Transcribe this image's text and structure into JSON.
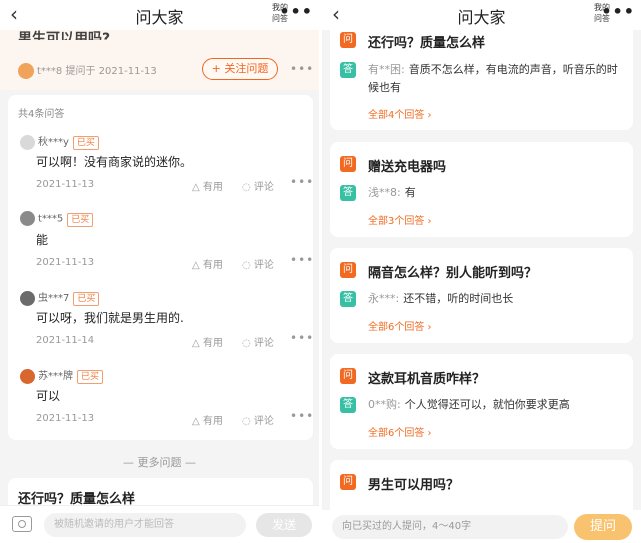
{
  "left": {
    "nav": {
      "back": "‹",
      "title": "问大家",
      "mine": "我的问答",
      "more": "•••"
    },
    "question": {
      "cut_title": "男生可以用吗?",
      "user": "t***8",
      "asked_on": "提问于 2021-11-13",
      "follow_label": "+ 关注问题",
      "more": "•••"
    },
    "answer_count": "共4条问答",
    "answers": [
      {
        "user": "秋***y",
        "badge": "已买",
        "text": "可以啊！没有商家说的迷你。",
        "date": "2021-11-13",
        "useful": "有用",
        "comment": "评论",
        "more": "•••",
        "avatar_color": "#d9d9d9"
      },
      {
        "user": "t***5",
        "badge": "已买",
        "text": "能",
        "date": "2021-11-13",
        "useful": "有用",
        "comment": "评论",
        "more": "•••",
        "avatar_color": "#8a8a8a"
      },
      {
        "user": "虫***7",
        "badge": "已买",
        "text": "可以呀，我们就是男生用的.",
        "date": "2021-11-14",
        "useful": "有用",
        "comment": "评论",
        "more": "•••",
        "avatar_color": "#6b6b6b"
      },
      {
        "user": "苏***牌",
        "badge": "已买",
        "text": "可以",
        "date": "2021-11-13",
        "useful": "有用",
        "comment": "评论",
        "more": "•••",
        "avatar_color": "#d9662e"
      }
    ],
    "more_questions": "— 更多问题 —",
    "peek_question": "还行吗？质量怎么样",
    "input_placeholder": "被随机邀请的用户才能回答",
    "send_label": "发送"
  },
  "right": {
    "nav": {
      "back": "‹",
      "title": "问大家",
      "mine": "我的问答",
      "more": "•••"
    },
    "q_icon": "问",
    "a_icon": "答",
    "questions": [
      {
        "question": "还行吗？质量怎么样",
        "answer_user": "有**困:",
        "answer": "音质不怎么样，有电流的声音，听音乐的时候也有",
        "all": "全部4个回答 ›"
      },
      {
        "question": "赠送充电器吗",
        "answer_user": "浅**8:",
        "answer": "有",
        "all": "全部3个回答 ›"
      },
      {
        "question": "隔音怎么样？别人能听到吗？",
        "answer_user": "永***:",
        "answer": "还不错，听的时间也长",
        "all": "全部6个回答 ›"
      },
      {
        "question": "这款耳机音质咋样？",
        "answer_user": "0**购:",
        "answer": "个人觉得还可以，就怕你要求更高",
        "all": "全部6个回答 ›"
      },
      {
        "question": "男生可以用吗？"
      }
    ],
    "input_placeholder": "向已买过的人提问，4～40字",
    "ask_label": "提问"
  }
}
